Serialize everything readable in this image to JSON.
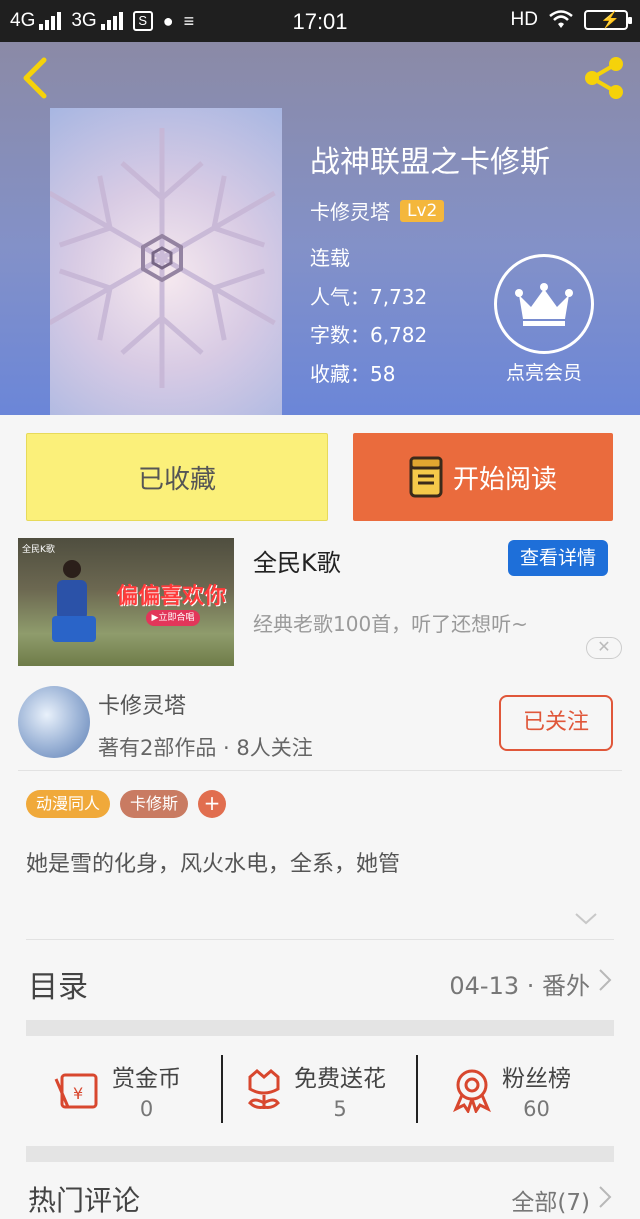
{
  "status_bar": {
    "network1": "4G",
    "network2": "3G",
    "time": "17:01",
    "hd": "HD"
  },
  "book": {
    "title": "战神联盟之卡修斯",
    "author": "卡修灵塔",
    "level": "Lv2",
    "status": "连载",
    "popularity": "人气：7,732",
    "word_count": "字数：6,782",
    "favorites": "收藏：58"
  },
  "vip": {
    "label": "点亮会员"
  },
  "actions": {
    "collected_label": "已收藏",
    "read_label": "开始阅读"
  },
  "ad": {
    "title": "全民K歌",
    "detail_label": "查看详情",
    "description": "经典老歌100首，听了还想听~",
    "close": "✕",
    "brand": "全民K歌",
    "banner_text": "偏偏喜欢你",
    "banner_cta": "▶立即合唱"
  },
  "author_card": {
    "name": "卡修灵塔",
    "stats": "著有2部作品 · 8人关注",
    "follow_label": "已关注"
  },
  "tags": [
    {
      "label": "动漫同人",
      "color": "#f0a93a"
    },
    {
      "label": "卡修斯",
      "color": "#c97b62"
    }
  ],
  "tag_add": "+",
  "description": "她是雪的化身，风火水电，全系，她管",
  "toc": {
    "label": "目录",
    "latest": "04-13 · 番外"
  },
  "stats": [
    {
      "label": "赏金币",
      "value": "0"
    },
    {
      "label": "免费送花",
      "value": "5"
    },
    {
      "label": "粉丝榜",
      "value": "60"
    }
  ],
  "comments": {
    "label": "热门评论",
    "all_label": "全部(7)"
  },
  "colors": {
    "accent_orange": "#ea6b3d",
    "collected_yellow": "#fbf07a",
    "icon_red": "#d8472e",
    "detail_blue": "#1e6fd9"
  }
}
